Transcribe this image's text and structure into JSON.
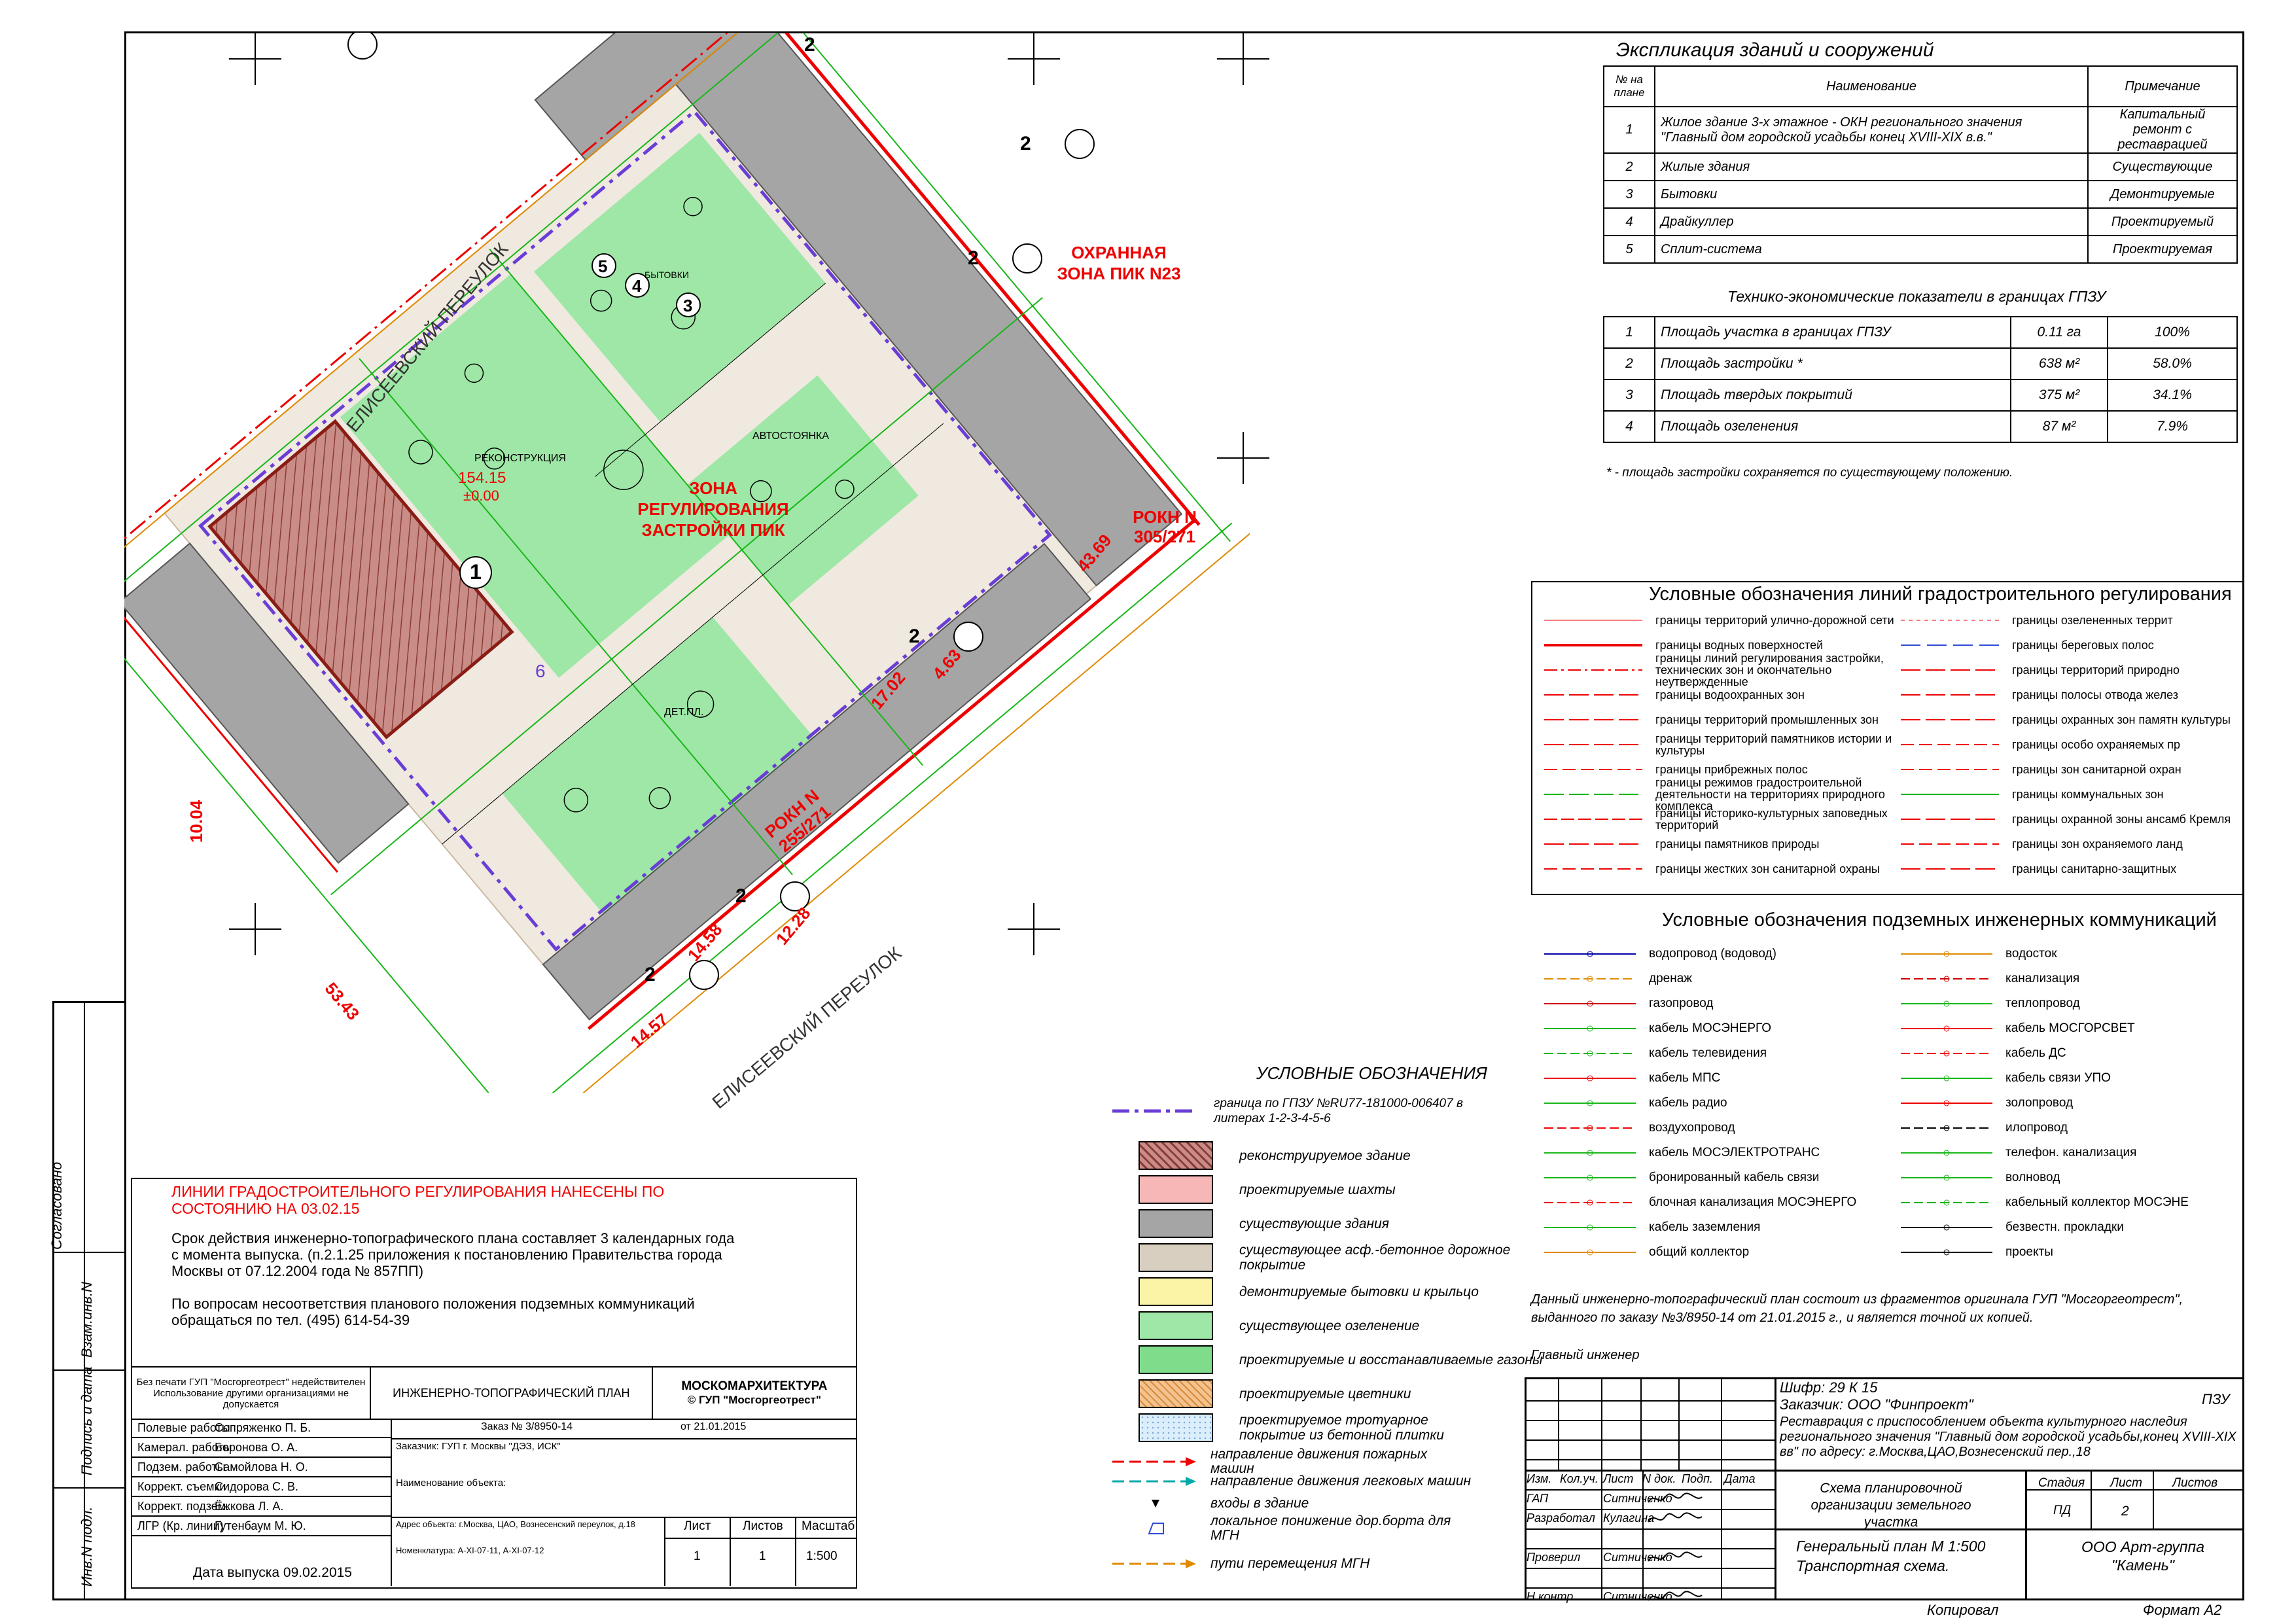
{
  "explication": {
    "title": "Экспликация зданий и сооружений",
    "headers": [
      "№ на плане",
      "Наименование",
      "Примечание"
    ],
    "rows": [
      {
        "num": "1",
        "name": "Жилое здание 3-х этажное - ОКН регионального значения \"Главный дом городской усадьбы конец XVIII-XIX в.в.\"",
        "note": "Капитальный ремонт с реставрацией"
      },
      {
        "num": "2",
        "name": "Жилые здания",
        "note": "Существующие"
      },
      {
        "num": "3",
        "name": "Бытовки",
        "note": "Демонтируемые"
      },
      {
        "num": "4",
        "name": "Драйкуллер",
        "note": "Проектируемый"
      },
      {
        "num": "5",
        "name": "Сплит-система",
        "note": "Проектируемая"
      }
    ]
  },
  "tep": {
    "title": "Технико-экономические показатели в границах ГПЗУ",
    "rows": [
      {
        "num": "1",
        "name": "Площадь участка в границах ГПЗУ",
        "value": "0.11 га",
        "pct": "100%"
      },
      {
        "num": "2",
        "name": "Площадь застройки *",
        "value": "638 м²",
        "pct": "58.0%"
      },
      {
        "num": "3",
        "name": "Площадь твердых покрытий",
        "value": "375 м²",
        "pct": "34.1%"
      },
      {
        "num": "4",
        "name": "Площадь озеленения",
        "value": "87 м²",
        "pct": "7.9%"
      }
    ],
    "footnote": "* - площадь застройки сохраняется по существующему положению."
  },
  "reg_lines": {
    "title": "Условные обозначения линий градостроительного регулирования",
    "left": [
      "границы территорий улично-дорожной сети",
      "границы водных поверхностей",
      "границы линий регулирования застройки, технических зон и окончательно неутвержденные",
      "границы водоохранных зон",
      "границы территорий промышленных зон",
      "границы территорий памятников истории и культуры",
      "границы прибрежных полос",
      "границы режимов градостроительной деятельности на территориях природного комплекса",
      "границы историко-культурных заповедных территорий",
      "границы памятников природы",
      "границы жестких зон санитарной охраны"
    ],
    "right": [
      "границы озелененных террит",
      "границы береговых полос",
      "границы территорий природно",
      "границы полосы отвода желез",
      "границы охранных зон памятн культуры",
      "границы особо охраняемых пр",
      "границы зон санитарной охран",
      "границы коммунальных зон",
      "границы охранной зоны ансамб Кремля",
      "границы зон охраняемого ланд",
      "границы санитарно-защитных"
    ]
  },
  "utilities": {
    "title": "Условные обозначения подземных инженерных коммуникаций",
    "left": [
      "водопровод (водовод)",
      "дренаж",
      "газопровод",
      "кабель МОСЭНЕРГО",
      "кабель телевидения",
      "кабель МПС",
      "кабель радио",
      "воздухопровод",
      "кабель МОСЭЛЕКТРОТРАНС",
      "бронированный кабель связи",
      "блочная канализация МОСЭНЕРГО",
      "кабель заземления",
      "общий коллектор"
    ],
    "right": [
      "водосток",
      "канализация",
      "теплопровод",
      "кабель МОСГОРСВЕТ",
      "кабель ДС",
      "кабель связи УПО",
      "золопровод",
      "илопровод",
      "телефон. канализация",
      "волновод",
      "кабельный коллектор МОСЭНЕ",
      "безвестн. прокладки",
      "проекты"
    ]
  },
  "legend": {
    "title": "УСЛОВНЫЕ ОБОЗНАЧЕНИЯ",
    "boundary": "граница по ГПЗУ №RU77-181000-006407 в литерах 1-2-3-4-5-6",
    "items": [
      {
        "label": "реконструируемое здание",
        "color": "#c98c87"
      },
      {
        "label": "проектируемые шахты",
        "color": "#f7b7b7"
      },
      {
        "label": "существующие здания",
        "color": "#a5a5a5"
      },
      {
        "label": "существующее асф.-бетонное дорожное покрытие",
        "color": "#d8cfc0"
      },
      {
        "label": "демонтируемые бытовки и крыльцо",
        "color": "#fbf3a6"
      },
      {
        "label": "существующее озеленение",
        "color": "#9ee7a6"
      },
      {
        "label": "проектируемые и восстанавливаемые газоны",
        "color": "#7fdc8b"
      },
      {
        "label": "проектируемые цветники",
        "color": "#f3c28f"
      },
      {
        "label": "проектируемое тротуарное покрытие из бетонной плитки",
        "color": "#dbeefb"
      }
    ],
    "arrows": [
      "направление движения пожарных машин",
      "направление движения легковых машин",
      "входы в здание",
      "локальное понижение дор.борта для МГН",
      "пути перемещения МГН"
    ]
  },
  "notes": {
    "red_title": "ЛИНИИ ГРАДОСТРОИТЕЛЬНОГО РЕГУЛИРОВАНИЯ НАНЕСЕНЫ ПО СОСТОЯНИЮ НА 03.02.15",
    "validity": "Срок действия инженерно-топографического плана составляет 3 календарных года с момента выпуска. (п.2.1.25 приложения к постановлению Правительства города Москвы от 07.12.2004 года № 857ПП)",
    "contact": "По вопросам несоответствия планового положения подземных коммуникаций обращаться по тел. (495) 614-54-39"
  },
  "topo_stamp": {
    "warning": "Без печати ГУП \"Мосгоргеотрест\" недействителен Использование другими организациями не допускается",
    "plan_title": "ИНЖЕНЕРНО-ТОПОГРАФИЧЕСКИЙ ПЛАН",
    "org1": "МОСКОМАРХИТЕКТУРА",
    "org2": "© ГУП \"Мосгоргеотрест\"",
    "order": "Заказ № 3/8950-14",
    "from": "от  21.01.2015",
    "customer": "Заказчик: ГУП г. Москвы \"ДЭЗ, ИСК\"",
    "object": "Наименование объекта:",
    "address": "Адрес объекта: г.Москва, ЦАО, Вознесенский переулок, д.18",
    "nomenclature": "Номенклатура: А-XI-07-11, А-XI-07-12",
    "roles": [
      "Полевые работы",
      "Камерал. работы",
      "Подзем. работы",
      "Коррект. съемки",
      "Коррект. подзем.",
      "ЛГР (Кр. линии)"
    ],
    "names": [
      "Сопряженко П. Б.",
      "Боронова О. А.",
      "Самойлова Н. О.",
      "Сидорова С. В.",
      "Ёжкова Л. А.",
      "Гутенбаум М. Ю."
    ],
    "sheet_label": "Лист",
    "sheets_label": "Листов",
    "scale_label": "Масштаб",
    "sheet": "1",
    "sheets": "1",
    "scale": "1:500",
    "release": "Дата выпуска 09.02.2015"
  },
  "copy_note": "Данный инженерно-топографический план состоит из фрагментов оригинала ГУП \"Мосгоргеотрест\", выданного по заказу №3/8950-14 от 21.01.2015 г., и является точной их копией.",
  "chief": "Главный инженер",
  "main_stamp": {
    "cipher": "Шифр: 29 К 15",
    "customer": "Заказчик: ООО \"Финпроект\"",
    "section": "ПЗУ",
    "project": "Реставрация с приспособлением объекта культурного наследия регионального значения \"Главный дом городской усадьбы,конец XVIII-XIX вв\" по адресу: г.Москва,ЦАО,Вознесенский пер.,18",
    "cols": [
      "Изм.",
      "Кол.уч.",
      "Лист",
      "N док.",
      "Подп.",
      "Дата"
    ],
    "people": [
      {
        "role": "ГАП",
        "name": "Ситниченко"
      },
      {
        "role": "Разработал",
        "name": "Кулагина"
      },
      {
        "role": "",
        "name": ""
      },
      {
        "role": "Проверил",
        "name": "Ситниченко"
      },
      {
        "role": "",
        "name": ""
      },
      {
        "role": "Н.контр.",
        "name": "Ситниченко"
      }
    ],
    "sheet_name": "Схема планировочной организации земельного участка",
    "stage_label": "Стадия",
    "sheet_label": "Лист",
    "sheets_label": "Листов",
    "stage": "ПД",
    "sheet": "2",
    "sheets": "",
    "drawing": "Генеральный план М 1:500 Транспортная схема.",
    "company": "ООО Арт-группа \"Камень\"",
    "copied": "Копировал",
    "format": "Формат А2"
  },
  "side": {
    "agreed": "Согласовано",
    "inv_replace": "Взам.инв.N",
    "sign_date": "Подпись и дата",
    "inv_orig": "Инв.N подл."
  },
  "map_labels": {
    "zone1": "ОХРАННАЯ ЗОНА ПИК N23",
    "zone2": "ЗОНА РЕГУЛИРОВАНИЯ ЗАСТРОЙКИ ПИК",
    "rokn1": "РОКН N 305/271",
    "rokn2": "РОКН N 255/271",
    "street1": "ЕЛИСЕЕВСКИЙ ПЕРЕУЛОК",
    "street2": "ЕЛИСЕЕВСКИЙ ПЕРЕУЛОК",
    "rekon": "РЕКОНСТРУКЦИЯ",
    "height": "154.15",
    "zero": "±0.00",
    "v1": "53.43",
    "v2": "10.04",
    "v3": "43.69",
    "v4": "14.58",
    "v5": "14.57",
    "v6": "12.28",
    "v7": "17.02",
    "v8": "4.63",
    "bldg": "2",
    "n1": "1",
    "n3": "3",
    "n4": "4",
    "n5": "5",
    "n6": "6",
    "avto": "АВТОСТОЯНКА",
    "dlit": "ДЕТ.ПЛ.",
    "bytovki": "БЫТОВКИ"
  }
}
